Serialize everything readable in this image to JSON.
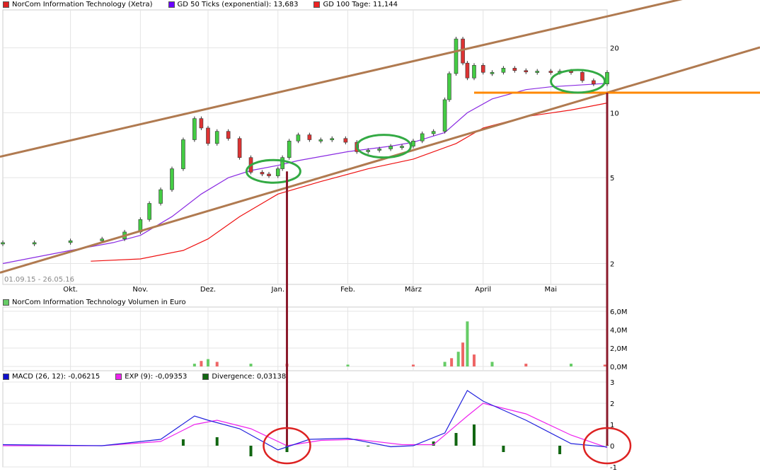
{
  "legend_price": [
    {
      "label": "NorCom Information Technology (Xetra)",
      "color": "#dd2222"
    },
    {
      "label": "GD 50 Ticks (exponential): 13,683",
      "color": "#6a00ff"
    },
    {
      "label": "GD 100 Tage: 11,144",
      "color": "#ee2222"
    }
  ],
  "legend_volume": [
    {
      "label": "NorCom Information Technology Volumen in Euro",
      "color": "#66cc66"
    }
  ],
  "legend_macd": [
    {
      "label": "MACD (26, 12): -0,06215",
      "color": "#1010cc"
    },
    {
      "label": "EXP (9): -0,09353",
      "color": "#ee22ee"
    },
    {
      "label": "Divergence: 0,03138",
      "color": "#116611"
    }
  ],
  "date_range": "01.09.15 - 26.05.16",
  "chart_data": [
    {
      "type": "line",
      "title": "NorCom Information Technology (Xetra)",
      "scale": "log",
      "ylim": [
        1.6,
        30
      ],
      "y_ticks": [
        {
          "v": 2,
          "label": "2"
        },
        {
          "v": 5,
          "label": "5"
        },
        {
          "v": 10,
          "label": "10"
        },
        {
          "v": 20,
          "label": "20"
        }
      ],
      "month_ticks": [
        {
          "date": "2015-10-01",
          "label": "Okt."
        },
        {
          "date": "2015-11-01",
          "label": "Nov."
        },
        {
          "date": "2015-12-01",
          "label": "Dez."
        },
        {
          "date": "2016-01-01",
          "label": "Jan."
        },
        {
          "date": "2016-02-01",
          "label": "Feb."
        },
        {
          "date": "2016-03-01",
          "label": "März"
        },
        {
          "date": "2016-04-01",
          "label": "April"
        },
        {
          "date": "2016-05-01",
          "label": "Mai"
        }
      ],
      "x_range": [
        "2015-09-01",
        "2016-05-26"
      ],
      "series": [
        {
          "name": "NorCom Information Technology (Xetra)",
          "color": "#22aa22",
          "x": [
            "2015-09-01",
            "2015-09-15",
            "2015-10-01",
            "2015-10-15",
            "2015-10-25",
            "2015-11-01",
            "2015-11-05",
            "2015-11-10",
            "2015-11-15",
            "2015-11-20",
            "2015-11-25",
            "2015-11-28",
            "2015-12-01",
            "2015-12-05",
            "2015-12-10",
            "2015-12-15",
            "2015-12-20",
            "2015-12-25",
            "2015-12-28",
            "2016-01-01",
            "2016-01-03",
            "2016-01-06",
            "2016-01-10",
            "2016-01-15",
            "2016-01-20",
            "2016-01-25",
            "2016-01-31",
            "2016-02-05",
            "2016-02-10",
            "2016-02-15",
            "2016-02-20",
            "2016-02-25",
            "2016-03-01",
            "2016-03-05",
            "2016-03-10",
            "2016-03-15",
            "2016-03-17",
            "2016-03-20",
            "2016-03-23",
            "2016-03-25",
            "2016-03-28",
            "2016-04-01",
            "2016-04-05",
            "2016-04-10",
            "2016-04-15",
            "2016-04-20",
            "2016-04-25",
            "2016-05-01",
            "2016-05-05",
            "2016-05-10",
            "2016-05-15",
            "2016-05-20",
            "2016-05-26"
          ],
          "y": [
            2.5,
            2.5,
            2.55,
            2.6,
            2.8,
            3.2,
            3.8,
            4.4,
            5.5,
            7.5,
            9.4,
            8.5,
            7.2,
            8.2,
            7.6,
            6.2,
            5.3,
            5.2,
            5.1,
            5.5,
            6.2,
            7.4,
            7.9,
            7.5,
            7.5,
            7.6,
            7.3,
            6.6,
            6.7,
            6.8,
            7.0,
            7.0,
            7.4,
            8.0,
            8.2,
            11.5,
            15.2,
            22,
            17,
            14.5,
            16.6,
            15.4,
            15.4,
            16.1,
            15.7,
            15.5,
            15.6,
            15.4,
            15.6,
            15.4,
            14.1,
            13.6,
            15.4
          ]
        },
        {
          "name": "GD 50 Ticks (exponential): 13,683",
          "color": "#8a2be2",
          "x": [
            "2015-09-01",
            "2015-10-01",
            "2015-10-20",
            "2015-11-01",
            "2015-11-15",
            "2015-11-28",
            "2015-12-10",
            "2015-12-20",
            "2016-01-01",
            "2016-01-10",
            "2016-02-01",
            "2016-02-20",
            "2016-03-01",
            "2016-03-15",
            "2016-03-25",
            "2016-04-05",
            "2016-04-20",
            "2016-05-01",
            "2016-05-26"
          ],
          "y": [
            2.0,
            2.3,
            2.5,
            2.7,
            3.3,
            4.2,
            5.0,
            5.4,
            5.7,
            6.0,
            6.6,
            7.0,
            7.3,
            8.1,
            10.0,
            11.6,
            12.8,
            13.2,
            13.7
          ]
        },
        {
          "name": "GD 100 Tage: 11,144",
          "color": "#e11",
          "x": [
            "2015-10-10",
            "2015-11-01",
            "2015-11-20",
            "2015-12-01",
            "2015-12-15",
            "2016-01-01",
            "2016-01-20",
            "2016-02-10",
            "2016-03-01",
            "2016-03-20",
            "2016-04-01",
            "2016-04-20",
            "2016-05-10",
            "2016-05-26"
          ],
          "y": [
            2.05,
            2.1,
            2.3,
            2.6,
            3.3,
            4.2,
            4.8,
            5.5,
            6.1,
            7.2,
            8.5,
            9.6,
            10.3,
            11.1
          ]
        }
      ],
      "annotations": [
        {
          "kind": "trendline",
          "x": [
            "2015-09-01",
            "2016-05-26"
          ],
          "y": [
            6.3,
            28
          ],
          "color": "#b07a50"
        },
        {
          "kind": "trendline",
          "x": [
            "2015-09-01",
            "2016-05-26"
          ],
          "y": [
            1.83,
            12.4
          ],
          "color": "#b07a50"
        },
        {
          "kind": "horizontal",
          "x": [
            "2016-03-28",
            "2016-05-26"
          ],
          "y": [
            12.4,
            12.4
          ],
          "color": "#ff8800"
        },
        {
          "kind": "ellipse",
          "x": "2015-12-30",
          "y": 5.35,
          "color": "#33aa44"
        },
        {
          "kind": "ellipse",
          "x": "2016-02-17",
          "y": 7.0,
          "color": "#33aa44"
        },
        {
          "kind": "ellipse",
          "x": "2016-05-13",
          "y": 14.0,
          "color": "#33aa44"
        }
      ]
    },
    {
      "type": "bar",
      "title": "NorCom Information Technology Volumen in Euro",
      "ylim": [
        0,
        6.0
      ],
      "y_ticks": [
        {
          "v": 0,
          "label": "0,0M"
        },
        {
          "v": 2,
          "label": "2,0M"
        },
        {
          "v": 4,
          "label": "4,0M"
        },
        {
          "v": 6,
          "label": "6,0M"
        }
      ],
      "series": [
        {
          "name": "NorCom Information Technology Volumen in Euro",
          "x": [
            "2015-11-25",
            "2015-11-28",
            "2015-12-01",
            "2015-12-05",
            "2015-12-20",
            "2016-01-05",
            "2016-02-01",
            "2016-03-01",
            "2016-03-15",
            "2016-03-18",
            "2016-03-21",
            "2016-03-23",
            "2016-03-25",
            "2016-03-28",
            "2016-04-05",
            "2016-04-20",
            "2016-05-10",
            "2016-05-25"
          ],
          "values": [
            0.3,
            0.6,
            0.8,
            0.5,
            0.3,
            0.3,
            0.2,
            0.2,
            0.5,
            0.9,
            1.6,
            2.6,
            4.9,
            1.3,
            0.5,
            0.3,
            0.3,
            0.2
          ]
        }
      ]
    },
    {
      "type": "line",
      "title": "MACD (26, 12)",
      "ylim": [
        -1,
        3
      ],
      "y_ticks": [
        {
          "v": -1,
          "label": "-1"
        },
        {
          "v": 0,
          "label": "0"
        },
        {
          "v": 1,
          "label": "1"
        },
        {
          "v": 2,
          "label": "2"
        },
        {
          "v": 3,
          "label": "3"
        }
      ],
      "series": [
        {
          "name": "MACD (26, 12): -0,06215",
          "color": "#2222dd",
          "x": [
            "2015-09-01",
            "2015-10-15",
            "2015-11-10",
            "2015-11-25",
            "2015-12-01",
            "2015-12-15",
            "2016-01-01",
            "2016-01-15",
            "2016-02-01",
            "2016-02-20",
            "2016-03-01",
            "2016-03-15",
            "2016-03-25",
            "2016-04-01",
            "2016-04-20",
            "2016-05-10",
            "2016-05-26"
          ],
          "y": [
            0.05,
            0.0,
            0.3,
            1.4,
            1.2,
            0.8,
            -0.2,
            0.3,
            0.35,
            -0.05,
            0.0,
            0.6,
            2.6,
            2.1,
            1.2,
            0.1,
            -0.06
          ]
        },
        {
          "name": "EXP (9): -0,09353",
          "color": "#ee22ee",
          "x": [
            "2015-09-01",
            "2015-10-15",
            "2015-11-10",
            "2015-11-25",
            "2015-12-05",
            "2015-12-20",
            "2016-01-05",
            "2016-01-20",
            "2016-02-05",
            "2016-02-25",
            "2016-03-10",
            "2016-03-25",
            "2016-04-01",
            "2016-04-20",
            "2016-05-10",
            "2016-05-26"
          ],
          "y": [
            0.0,
            0.0,
            0.2,
            1.0,
            1.2,
            0.8,
            0.0,
            0.25,
            0.3,
            0.05,
            0.05,
            1.4,
            2.0,
            1.5,
            0.5,
            -0.09
          ]
        },
        {
          "name": "Divergence: 0,03138",
          "color": "#116611",
          "x": [
            "2015-11-20",
            "2015-12-05",
            "2015-12-20",
            "2016-01-05",
            "2016-02-10",
            "2016-03-10",
            "2016-03-20",
            "2016-03-28",
            "2016-04-10",
            "2016-05-05",
            "2016-05-26"
          ],
          "y": [
            0.3,
            0.4,
            -0.5,
            -0.3,
            0.0,
            0.2,
            0.6,
            1.0,
            -0.3,
            -0.4,
            0.03
          ]
        }
      ]
    }
  ]
}
